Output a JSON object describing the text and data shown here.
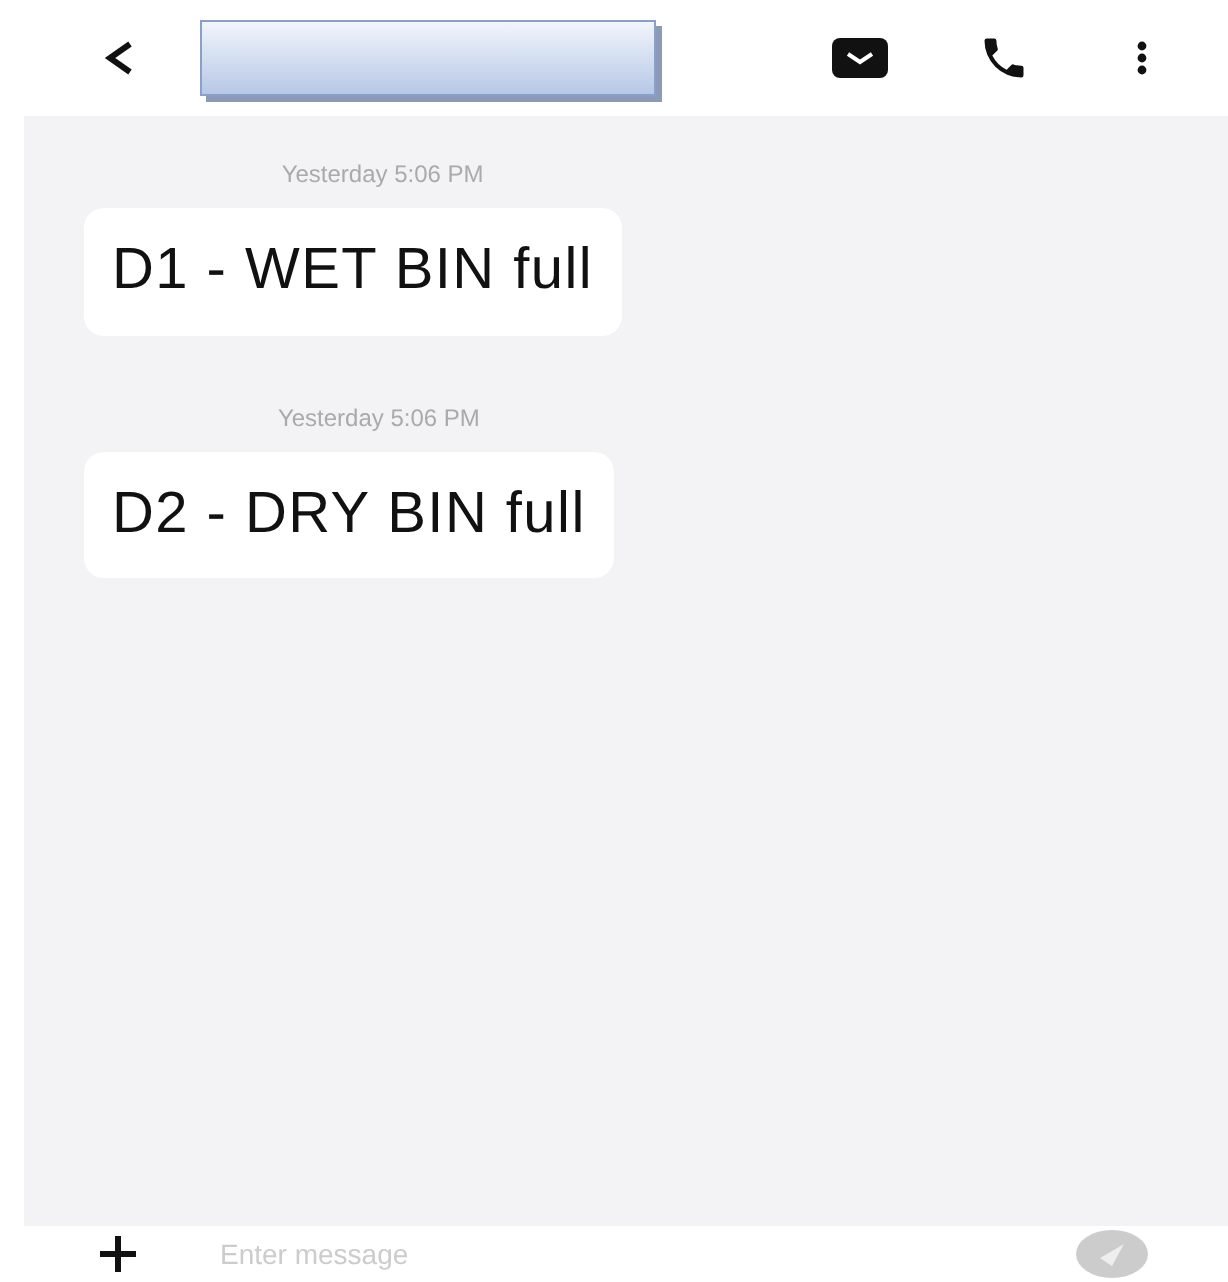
{
  "messages": [
    {
      "time": "Yesterday 5:06 PM",
      "text": "D1 - WET BIN full"
    },
    {
      "time": "Yesterday 5:06 PM",
      "text": "D2 - DRY BIN full"
    }
  ],
  "composer": {
    "placeholder": "Enter message"
  }
}
